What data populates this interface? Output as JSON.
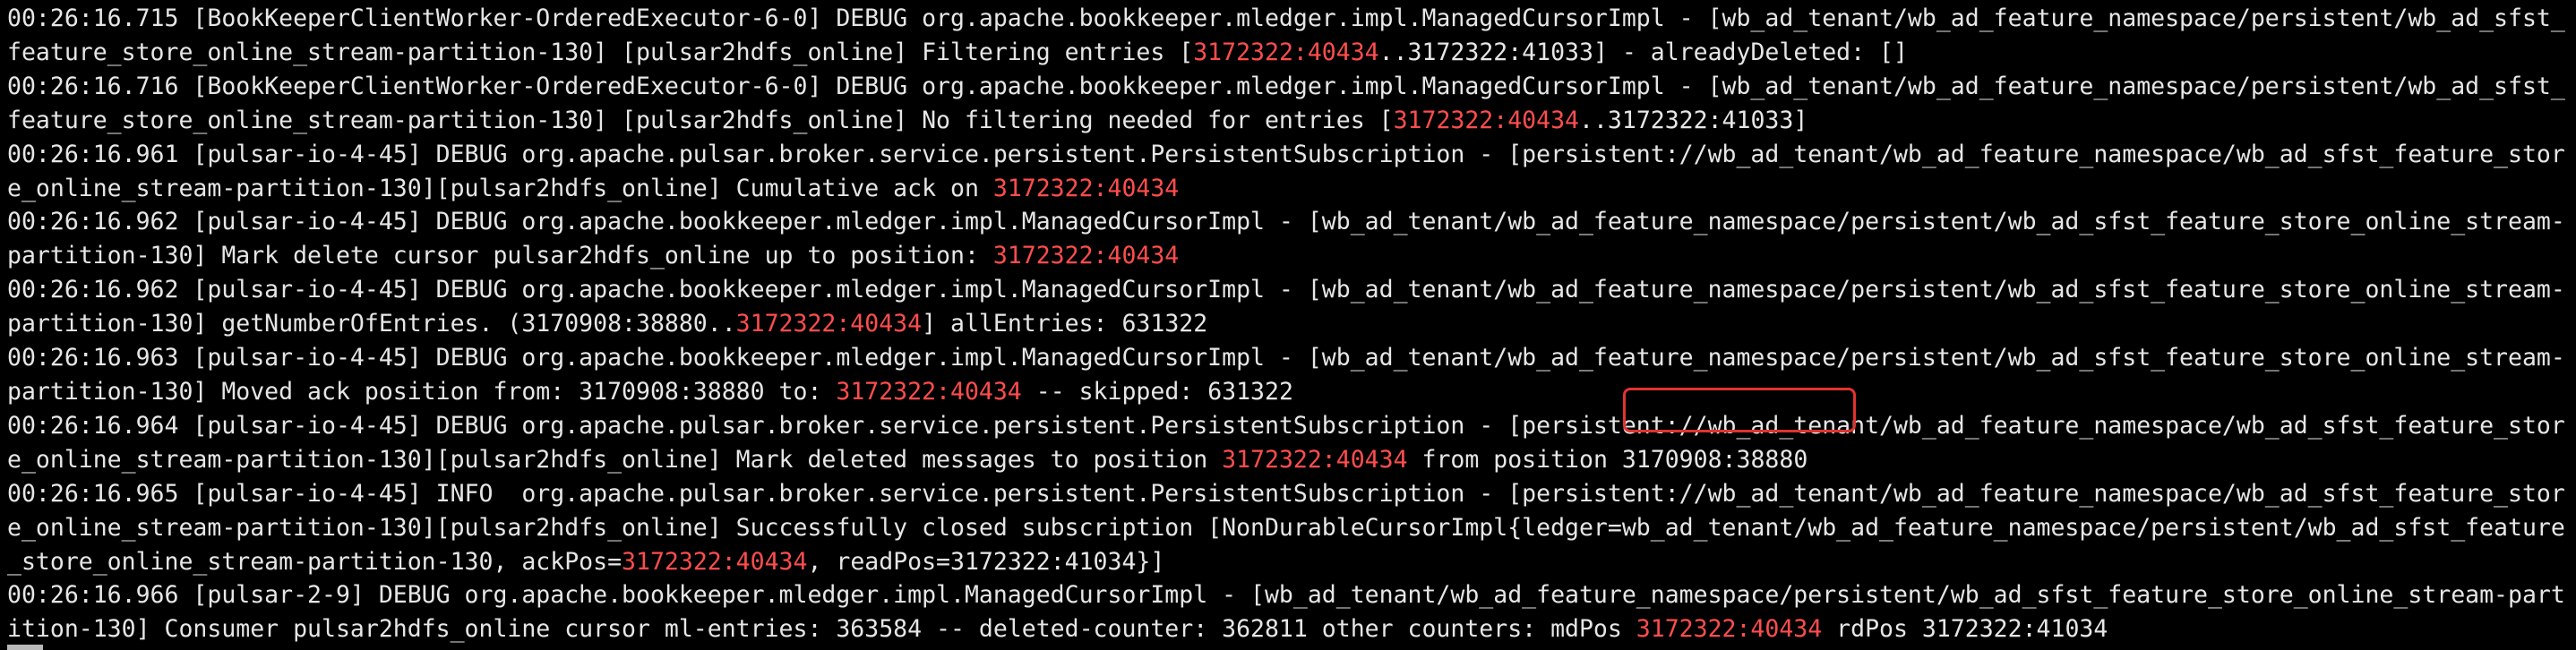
{
  "colors": {
    "background": "#000000",
    "text": "#e6e6e6",
    "highlight": "#ff4d4d",
    "annotation_box": "#e0332e"
  },
  "log_entries": [
    [
      {
        "t": "00:26:16.715 [BookKeeperClientWorker-OrderedExecutor-6-0] DEBUG org.apache.bookkeeper.mledger.impl.ManagedCursorImpl - [wb_ad_tenant/wb_ad_feature_namespace/persistent/wb_ad_sfst_feature_store_online_stream-partition-130] [pulsar2hdfs_online] Filtering entries [",
        "hl": false
      },
      {
        "t": "3172322:40434",
        "hl": true
      },
      {
        "t": "..3172322:41033] - alreadyDeleted: []",
        "hl": false
      }
    ],
    [
      {
        "t": "00:26:16.716 [BookKeeperClientWorker-OrderedExecutor-6-0] DEBUG org.apache.bookkeeper.mledger.impl.ManagedCursorImpl - [wb_ad_tenant/wb_ad_feature_namespace/persistent/wb_ad_sfst_feature_store_online_stream-partition-130] [pulsar2hdfs_online] No filtering needed for entries [",
        "hl": false
      },
      {
        "t": "3172322:40434",
        "hl": true
      },
      {
        "t": "..3172322:41033]",
        "hl": false
      }
    ],
    [
      {
        "t": "00:26:16.961 [pulsar-io-4-45] DEBUG org.apache.pulsar.broker.service.persistent.PersistentSubscription - [persistent://wb_ad_tenant/wb_ad_feature_namespace/wb_ad_sfst_feature_store_online_stream-partition-130][pulsar2hdfs_online] Cumulative ack on ",
        "hl": false
      },
      {
        "t": "3172322:40434",
        "hl": true
      }
    ],
    [
      {
        "t": "00:26:16.962 [pulsar-io-4-45] DEBUG org.apache.bookkeeper.mledger.impl.ManagedCursorImpl - [wb_ad_tenant/wb_ad_feature_namespace/persistent/wb_ad_sfst_feature_store_online_stream-partition-130] Mark delete cursor pulsar2hdfs_online up to position: ",
        "hl": false
      },
      {
        "t": "3172322:40434",
        "hl": true
      }
    ],
    [
      {
        "t": "00:26:16.962 [pulsar-io-4-45] DEBUG org.apache.bookkeeper.mledger.impl.ManagedCursorImpl - [wb_ad_tenant/wb_ad_feature_namespace/persistent/wb_ad_sfst_feature_store_online_stream-partition-130] getNumberOfEntries. (3170908:38880..",
        "hl": false
      },
      {
        "t": "3172322:40434",
        "hl": true
      },
      {
        "t": "] allEntries: 631322",
        "hl": false
      }
    ],
    [
      {
        "t": "00:26:16.963 [pulsar-io-4-45] DEBUG org.apache.bookkeeper.mledger.impl.ManagedCursorImpl - [wb_ad_tenant/wb_ad_feature_namespace/persistent/wb_ad_sfst_feature_store_online_stream-partition-130] Moved ack position from: 3170908:38880 to: ",
        "hl": false
      },
      {
        "t": "3172322:40434",
        "hl": true
      },
      {
        "t": " -- skipped: 631322",
        "hl": false
      }
    ],
    [
      {
        "t": "00:26:16.964 [pulsar-io-4-45] DEBUG org.apache.pulsar.broker.service.persistent.PersistentSubscription - [persistent://wb_ad_tenant/wb_ad_feature_namespace/wb_ad_sfst_feature_store_online_stream-partition-130][pulsar2hdfs_online] Mark deleted messages to position ",
        "hl": false
      },
      {
        "t": "3172322:40434",
        "hl": true
      },
      {
        "t": " from position 3170908:38880",
        "hl": false
      }
    ],
    [
      {
        "t": "00:26:16.965 [pulsar-io-4-45] INFO  org.apache.pulsar.broker.service.persistent.PersistentSubscription - [persistent://wb_ad_tenant/wb_ad_feature_namespace/wb_ad_sfst_feature_store_online_stream-partition-130][pulsar2hdfs_online] Successfully closed subscription [NonDurableCursorImpl{ledger=wb_ad_tenant/wb_ad_feature_namespace/persistent/wb_ad_sfst_feature_store_online_stream-partition-130, ackPos=",
        "hl": false
      },
      {
        "t": "3172322:40434",
        "hl": true
      },
      {
        "t": ", readPos=3172322:41034}]",
        "hl": false
      }
    ],
    [
      {
        "t": "00:26:16.966 [pulsar-2-9] DEBUG org.apache.bookkeeper.mledger.impl.ManagedCursorImpl - [wb_ad_tenant/wb_ad_feature_namespace/persistent/wb_ad_sfst_feature_store_online_stream-partition-130] Consumer pulsar2hdfs_online cursor ml-entries: 363584 -- deleted-counter: 362811 other counters: mdPos ",
        "hl": false
      },
      {
        "t": "3172322:40434",
        "hl": true
      },
      {
        "t": " rdPos 3172322:41034",
        "hl": false
      }
    ]
  ]
}
